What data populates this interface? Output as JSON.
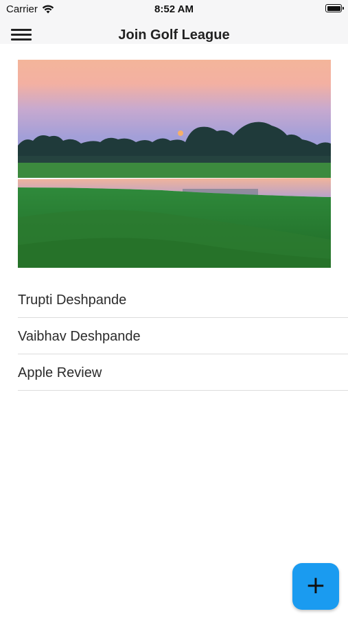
{
  "status_bar": {
    "carrier": "Carrier",
    "time": "8:52 AM",
    "wifi_icon": "wifi-icon",
    "battery_icon": "battery-icon"
  },
  "nav_bar": {
    "title": "Join Golf League",
    "menu_icon": "hamburger-menu-icon"
  },
  "hero_image": {
    "description_icon": "golf-course-photo"
  },
  "members": [
    {
      "label": "Trupti Deshpande"
    },
    {
      "label": "Vaibhav Deshpande"
    },
    {
      "label": "Apple Review"
    }
  ],
  "fab": {
    "icon": "plus-icon",
    "symbol": "+",
    "color": "#1a9bf0"
  }
}
